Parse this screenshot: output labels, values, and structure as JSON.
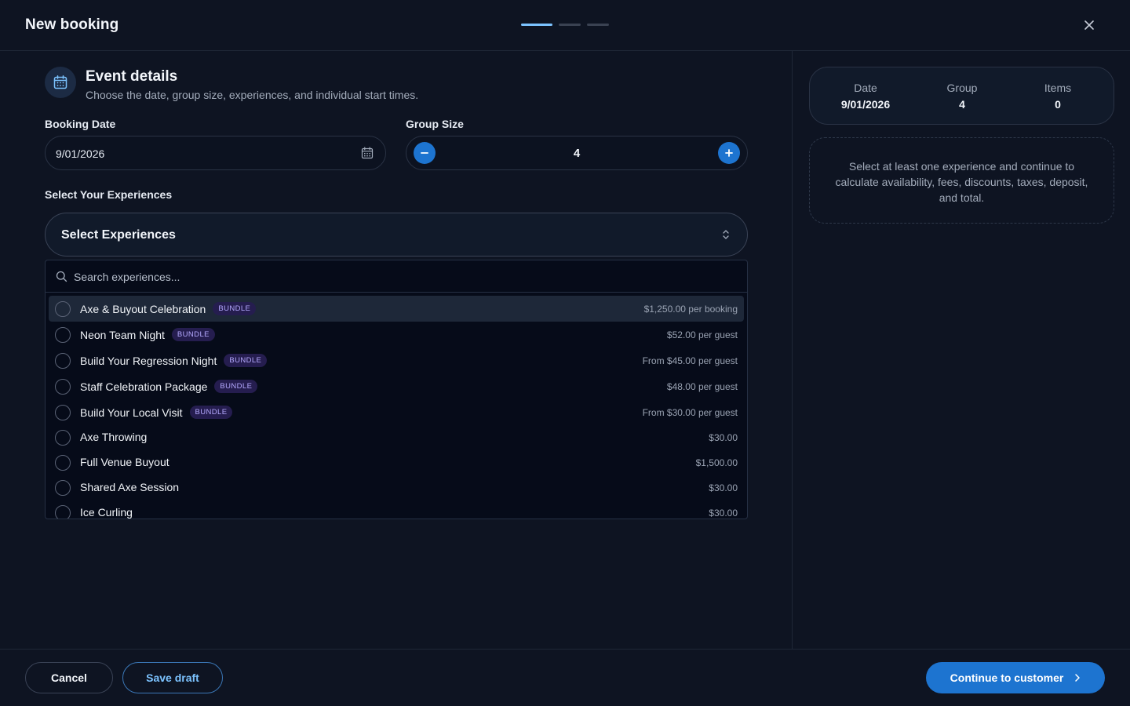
{
  "header": {
    "title": "New booking",
    "steps": [
      true,
      false,
      false
    ]
  },
  "section": {
    "title": "Event details",
    "subtitle": "Choose the date, group size, experiences, and individual start times."
  },
  "booking_date": {
    "label": "Booking Date",
    "value": "9/01/2026"
  },
  "group_size": {
    "label": "Group Size",
    "value": "4"
  },
  "experiences": {
    "label": "Select Your Experiences",
    "trigger_label": "Select Experiences",
    "search_placeholder": "Search experiences...",
    "options": [
      {
        "name": "Axe & Buyout Celebration",
        "badge": "BUNDLE",
        "price": "$1,250.00 per booking",
        "highlighted": true
      },
      {
        "name": "Neon Team Night",
        "badge": "BUNDLE",
        "price": "$52.00 per guest"
      },
      {
        "name": "Build Your Regression Night",
        "badge": "BUNDLE",
        "price": "From $45.00 per guest"
      },
      {
        "name": "Staff Celebration Package",
        "badge": "BUNDLE",
        "price": "$48.00 per guest"
      },
      {
        "name": "Build Your Local Visit",
        "badge": "BUNDLE",
        "price": "From $30.00 per guest"
      },
      {
        "name": "Axe Throwing",
        "badge": "",
        "price": "$30.00"
      },
      {
        "name": "Full Venue Buyout",
        "badge": "",
        "price": "$1,500.00"
      },
      {
        "name": "Shared Axe Session",
        "badge": "",
        "price": "$30.00"
      },
      {
        "name": "Ice Curling",
        "badge": "",
        "price": "$30.00"
      }
    ]
  },
  "summary": {
    "date_label": "Date",
    "date_value": "9/01/2026",
    "group_label": "Group",
    "group_value": "4",
    "items_label": "Items",
    "items_value": "0"
  },
  "note": "Select at least one experience and continue to calculate availability, fees, discounts, taxes, deposit, and total.",
  "footer": {
    "cancel": "Cancel",
    "save_draft": "Save draft",
    "continue": "Continue to customer"
  },
  "colors": {
    "background": "#0e1422",
    "accent": "#1d74d0",
    "accent_light": "#7cc3ff",
    "badge_bg": "#251d4f",
    "badge_text": "#b5a9ff"
  }
}
